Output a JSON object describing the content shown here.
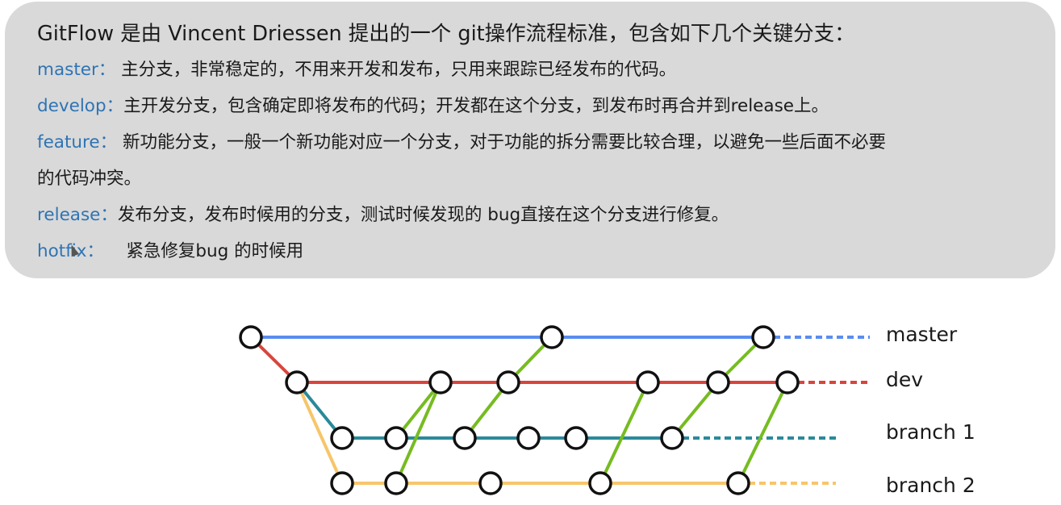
{
  "intro": {
    "title": "GitFlow 是由 Vincent Driessen 提出的一个 git操作流程标准，包含如下几个关键分支：",
    "items": [
      {
        "key": "master：",
        "desc": " 主分支，非常稳定的，不用来开发和发布，只用来跟踪已经发布的代码。"
      },
      {
        "key": "develop：",
        "desc": "主开发分支，包含确定即将发布的代码；开发都在这个分支，到发布时再合并到release上。"
      },
      {
        "key": "feature：",
        "desc": " 新功能分支，一般一个新功能对应一个分支，对于功能的拆分需要比较合理，以避免一些后面不必要",
        "desc_cont": "的代码冲突。"
      },
      {
        "key": "release：",
        "desc": "发布分支，发布时候用的分支，测试时候发现的 bug直接在这个分支进行修复。"
      },
      {
        "key": "hotfix：",
        "desc": "    紧急修复bug 的时候用"
      }
    ]
  },
  "diagram": {
    "branches": [
      {
        "id": "master",
        "label": "master",
        "color": "#5b8def"
      },
      {
        "id": "dev",
        "label": "dev",
        "color": "#d9453b"
      },
      {
        "id": "b1",
        "label": "branch 1",
        "color": "#2a8a99"
      },
      {
        "id": "b2",
        "label": "branch 2",
        "color": "#f7c56a"
      }
    ],
    "merge_color": "#76bc21"
  }
}
